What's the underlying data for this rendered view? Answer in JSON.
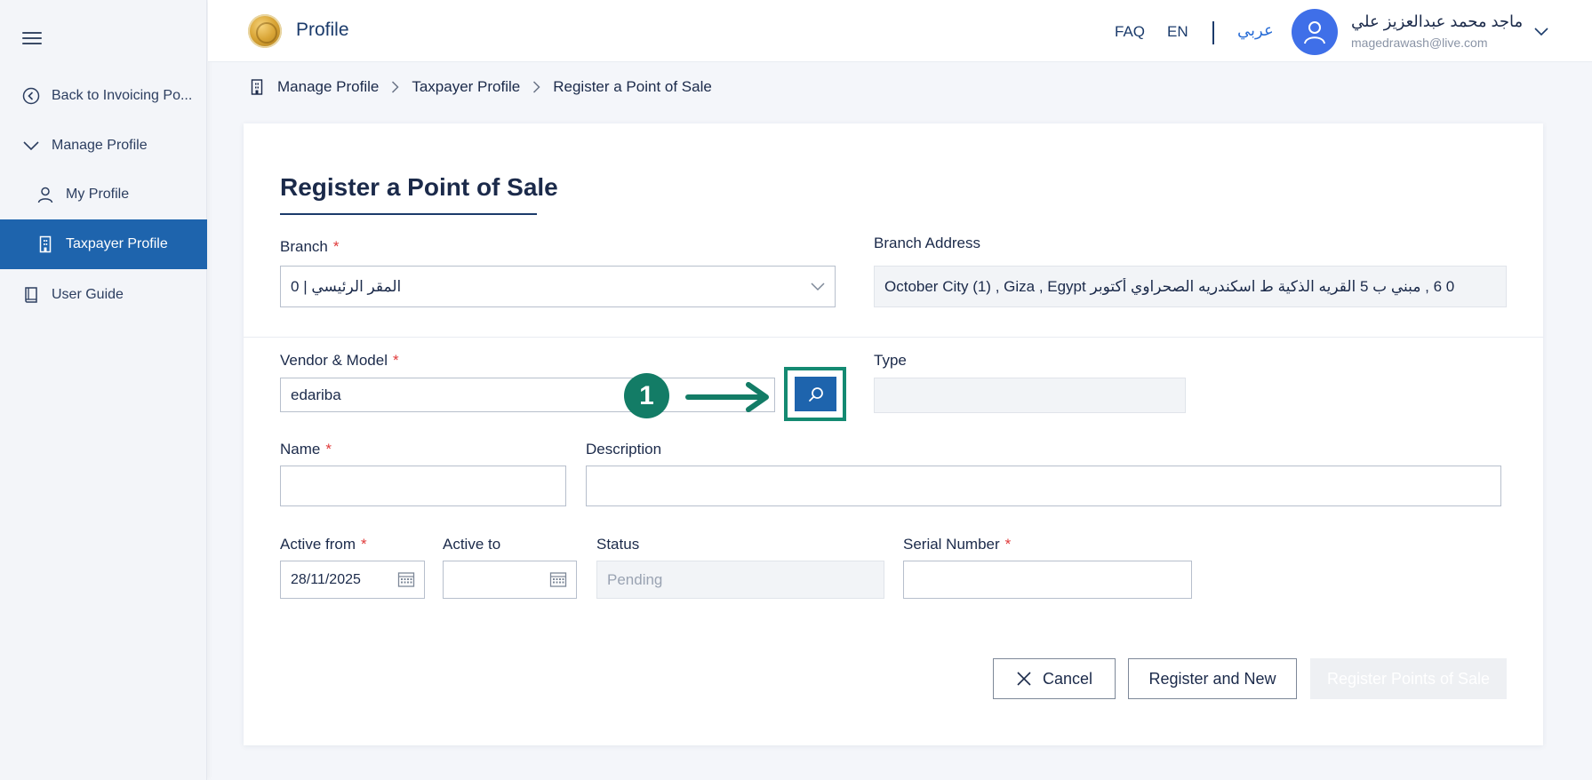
{
  "header": {
    "title": "Profile",
    "faq": "FAQ",
    "lang_en": "EN",
    "lang_ar": "عربي",
    "user_name": "ماجد محمد عبدالعزيز علي",
    "user_email": "magedrawash@live.com"
  },
  "sidebar": {
    "items": [
      {
        "label": "Back to Invoicing Po...",
        "icon": "back-circle-icon"
      },
      {
        "label": "Manage Profile",
        "icon": "chevron-down-icon"
      },
      {
        "label": "My Profile",
        "icon": "user-icon"
      },
      {
        "label": "Taxpayer Profile",
        "icon": "building-icon"
      },
      {
        "label": "User Guide",
        "icon": "book-icon"
      }
    ],
    "active_index": 3
  },
  "breadcrumb": {
    "items": [
      "Manage Profile",
      "Taxpayer Profile",
      "Register a Point of Sale"
    ]
  },
  "form": {
    "title": "Register a Point of Sale",
    "branch": {
      "label": "Branch",
      "value": "المقر الرئيسي | 0"
    },
    "branch_address": {
      "label": "Branch Address",
      "value": "0  6 , مبني ب 5 القريه الذكية ط اسكندريه الصحراوي أكتوبر October City (1) , Giza , Egypt"
    },
    "vendor_model": {
      "label": "Vendor & Model",
      "value": "edariba"
    },
    "type": {
      "label": "Type",
      "value": ""
    },
    "name": {
      "label": "Name",
      "value": ""
    },
    "description": {
      "label": "Description",
      "value": ""
    },
    "active_from": {
      "label": "Active from",
      "value": "28/11/2025"
    },
    "active_to": {
      "label": "Active to",
      "value": ""
    },
    "status": {
      "label": "Status",
      "value": "Pending"
    },
    "serial_number": {
      "label": "Serial Number",
      "value": ""
    }
  },
  "annotation": {
    "step": "1",
    "color": "#137c66"
  },
  "buttons": {
    "cancel": "Cancel",
    "register_new": "Register and New",
    "register_pos": "Register Points of Sale"
  },
  "colors": {
    "primary": "#1e64ad",
    "navy": "#1b3b6b",
    "required": "#e03a3a",
    "avatar": "#3f6fe8"
  }
}
